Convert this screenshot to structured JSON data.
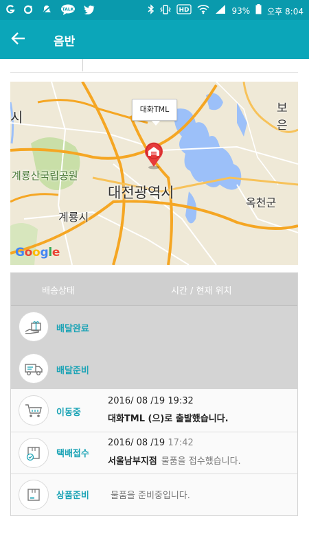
{
  "status_bar": {
    "left_icons": [
      "g-icon",
      "o-icon",
      "silent-mode-icon",
      "talk-icon",
      "twitter-icon"
    ],
    "talk_label": "TALK",
    "right_icons": [
      "bluetooth-icon",
      "vibrate-icon",
      "hd-icon",
      "wifi-icon",
      "signal-icon"
    ],
    "hd_label": "HD",
    "battery": "93%",
    "time": "오후 8:04"
  },
  "app_bar": {
    "title": "음반"
  },
  "map": {
    "callout_label": "대화TML",
    "place_labels": {
      "si": "시",
      "boeun": "보은",
      "gyeryongsan": "계룡산국립공원",
      "daejeon": "대전광역시",
      "okcheon": "옥천군",
      "gyeryong": "계룡시"
    },
    "google_logo": [
      "G",
      "o",
      "o",
      "g",
      "l",
      "e"
    ],
    "colors": {
      "land": "#efe9d7",
      "water": "#9cc0f9",
      "highway": "#f5a623",
      "road": "#ffffff",
      "park": "#c9dfa8",
      "pin": "#e63b3b"
    }
  },
  "tracking": {
    "header": {
      "status_col": "배송상태",
      "time_col": "시간 / 현재 위치"
    },
    "steps": [
      {
        "status": "배달완료",
        "icon": "gift-hand-icon",
        "time": "",
        "time2": "",
        "location": "",
        "message": ""
      },
      {
        "status": "배달준비",
        "icon": "delivery-truck-icon",
        "time": "",
        "time2": "",
        "location": "",
        "message": ""
      },
      {
        "status": "이동중",
        "icon": "cart-icon",
        "time": "2016/ 08 /19 19:32",
        "time2": "",
        "location": "",
        "message": "대화TML (으)로 출발했습니다."
      },
      {
        "status": "택배접수",
        "icon": "package-check-icon",
        "time": "2016/ 08 /19",
        "time2": "17:42",
        "location": "서울남부지점",
        "message": "물품을 접수했습니다."
      },
      {
        "status": "상품준비",
        "icon": "box-icon",
        "time": "",
        "time2": "",
        "location": "",
        "message": "물품을 준비중입니다."
      }
    ],
    "accent_color": "#1aa3b5"
  }
}
